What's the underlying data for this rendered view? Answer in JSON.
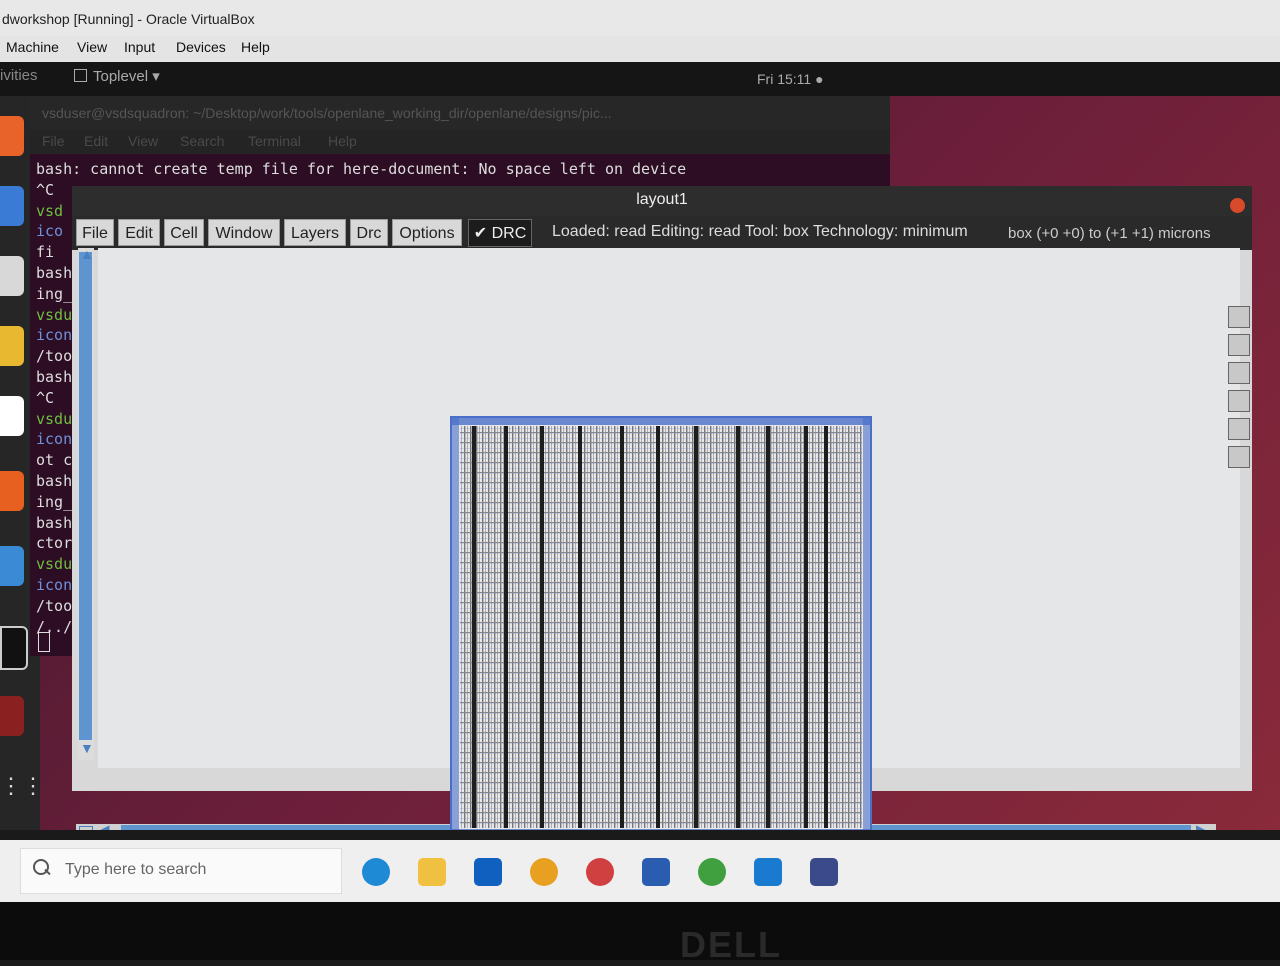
{
  "vbox": {
    "title": "dworkshop [Running] - Oracle VirtualBox",
    "menu": [
      "Machine",
      "View",
      "Input",
      "Devices",
      "Help"
    ]
  },
  "gnome": {
    "activities": "ivities",
    "toplevel": "Toplevel",
    "clock": "Fri 15:11 ●"
  },
  "terminal": {
    "title": "vsduser@vsdsquadron: ~/Desktop/work/tools/openlane_working_dir/openlane/designs/pic...",
    "menu": [
      "File",
      "Edit",
      "View",
      "Search",
      "Terminal",
      "Help"
    ],
    "lines": [
      {
        "text": "bash: cannot create temp file for here-document: No space left on device",
        "style": "plain"
      },
      {
        "text": "^C",
        "style": "plain"
      },
      {
        "text": "vsd",
        "style": "green"
      },
      {
        "text": "ico",
        "style": "blue"
      },
      {
        "text": " fi",
        "style": "plain"
      },
      {
        "text": "bash",
        "style": "plain"
      },
      {
        "text": "ing_",
        "style": "plain"
      },
      {
        "text": "vsdu",
        "style": "green"
      },
      {
        "text": "icon",
        "style": "blue"
      },
      {
        "text": "/too",
        "style": "plain"
      },
      {
        "text": "bash",
        "style": "plain"
      },
      {
        "text": "^C",
        "style": "plain"
      },
      {
        "text": "vsdu",
        "style": "green"
      },
      {
        "text": "icon",
        "style": "blue"
      },
      {
        "text": "ot c",
        "style": "plain"
      },
      {
        "text": "bash",
        "style": "plain"
      },
      {
        "text": "ing_",
        "style": "plain"
      },
      {
        "text": "bash",
        "style": "plain"
      },
      {
        "text": "ctor",
        "style": "plain"
      },
      {
        "text": "vsdu",
        "style": "green"
      },
      {
        "text": "icon",
        "style": "blue"
      },
      {
        "text": "/too",
        "style": "plain"
      },
      {
        "text": "/../",
        "style": "plain"
      }
    ]
  },
  "layout": {
    "window_title": "layout1",
    "menu": [
      "File",
      "Edit",
      "Cell",
      "Window",
      "Layers",
      "Drc",
      "Options"
    ],
    "drc_check": "✔",
    "drc_label": "DRC",
    "status": "Loaded: read Editing: read Tool: box Technology: minimum",
    "box_info": "box (+0 +0) to (+1 +1) microns"
  },
  "taskbar": {
    "search_placeholder": "Type here to search"
  },
  "bezel": {
    "logo": "DELL"
  }
}
